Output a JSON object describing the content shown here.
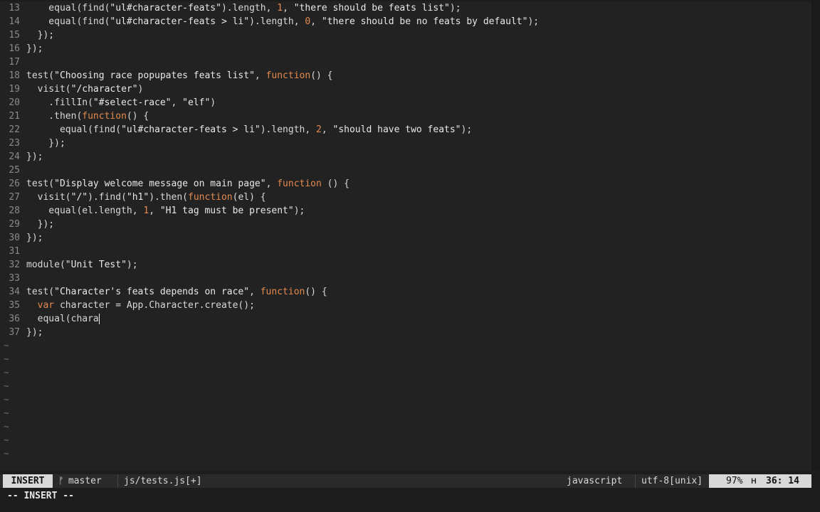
{
  "editor": {
    "lines": [
      {
        "n": "13",
        "parts": [
          {
            "t": "    equal(find(",
            "c": ""
          },
          {
            "t": "\"ul#character-feats\"",
            "c": "s"
          },
          {
            "t": ").length, ",
            "c": ""
          },
          {
            "t": "1",
            "c": "num"
          },
          {
            "t": ", ",
            "c": ""
          },
          {
            "t": "\"there should be feats list\"",
            "c": "s"
          },
          {
            "t": ");",
            "c": ""
          }
        ]
      },
      {
        "n": "14",
        "parts": [
          {
            "t": "    equal(find(",
            "c": ""
          },
          {
            "t": "\"ul#character-feats > li\"",
            "c": "s"
          },
          {
            "t": ").length, ",
            "c": ""
          },
          {
            "t": "0",
            "c": "num"
          },
          {
            "t": ", ",
            "c": ""
          },
          {
            "t": "\"there should be no feats by default\"",
            "c": "s"
          },
          {
            "t": ");",
            "c": ""
          }
        ]
      },
      {
        "n": "15",
        "parts": [
          {
            "t": "  });",
            "c": ""
          }
        ]
      },
      {
        "n": "16",
        "parts": [
          {
            "t": "});",
            "c": ""
          }
        ]
      },
      {
        "n": "17",
        "parts": []
      },
      {
        "n": "18",
        "parts": [
          {
            "t": "test(",
            "c": ""
          },
          {
            "t": "\"Choosing race popupates feats list\"",
            "c": "s"
          },
          {
            "t": ", ",
            "c": ""
          },
          {
            "t": "function",
            "c": "kw"
          },
          {
            "t": "() {",
            "c": ""
          }
        ]
      },
      {
        "n": "19",
        "parts": [
          {
            "t": "  visit(",
            "c": ""
          },
          {
            "t": "\"/character\"",
            "c": "s"
          },
          {
            "t": ")",
            "c": ""
          }
        ]
      },
      {
        "n": "20",
        "parts": [
          {
            "t": "    .fillIn(",
            "c": ""
          },
          {
            "t": "\"#select-race\"",
            "c": "s"
          },
          {
            "t": ", ",
            "c": ""
          },
          {
            "t": "\"elf\"",
            "c": "s"
          },
          {
            "t": ")",
            "c": ""
          }
        ]
      },
      {
        "n": "21",
        "parts": [
          {
            "t": "    .then(",
            "c": ""
          },
          {
            "t": "function",
            "c": "kw"
          },
          {
            "t": "() {",
            "c": ""
          }
        ]
      },
      {
        "n": "22",
        "parts": [
          {
            "t": "      equal(find(",
            "c": ""
          },
          {
            "t": "\"ul#character-feats > li\"",
            "c": "s"
          },
          {
            "t": ").length, ",
            "c": ""
          },
          {
            "t": "2",
            "c": "num"
          },
          {
            "t": ", ",
            "c": ""
          },
          {
            "t": "\"should have two feats\"",
            "c": "s"
          },
          {
            "t": ");",
            "c": ""
          }
        ]
      },
      {
        "n": "23",
        "parts": [
          {
            "t": "    });",
            "c": ""
          }
        ]
      },
      {
        "n": "24",
        "parts": [
          {
            "t": "});",
            "c": ""
          }
        ]
      },
      {
        "n": "25",
        "parts": []
      },
      {
        "n": "26",
        "parts": [
          {
            "t": "test(",
            "c": ""
          },
          {
            "t": "\"Display welcome message on main page\"",
            "c": "s"
          },
          {
            "t": ", ",
            "c": ""
          },
          {
            "t": "function",
            "c": "kw"
          },
          {
            "t": " () {",
            "c": ""
          }
        ]
      },
      {
        "n": "27",
        "parts": [
          {
            "t": "  visit(",
            "c": ""
          },
          {
            "t": "\"/\"",
            "c": "s"
          },
          {
            "t": ").find(",
            "c": ""
          },
          {
            "t": "\"h1\"",
            "c": "s"
          },
          {
            "t": ").then(",
            "c": ""
          },
          {
            "t": "function",
            "c": "kw"
          },
          {
            "t": "(el) {",
            "c": ""
          }
        ]
      },
      {
        "n": "28",
        "parts": [
          {
            "t": "    equal(el.length, ",
            "c": ""
          },
          {
            "t": "1",
            "c": "num"
          },
          {
            "t": ", ",
            "c": ""
          },
          {
            "t": "\"H1 tag must be present\"",
            "c": "s"
          },
          {
            "t": ");",
            "c": ""
          }
        ]
      },
      {
        "n": "29",
        "parts": [
          {
            "t": "  });",
            "c": ""
          }
        ]
      },
      {
        "n": "30",
        "parts": [
          {
            "t": "});",
            "c": ""
          }
        ]
      },
      {
        "n": "31",
        "parts": []
      },
      {
        "n": "32",
        "parts": [
          {
            "t": "module(",
            "c": ""
          },
          {
            "t": "\"Unit Test\"",
            "c": "s"
          },
          {
            "t": ");",
            "c": ""
          }
        ]
      },
      {
        "n": "33",
        "parts": []
      },
      {
        "n": "34",
        "parts": [
          {
            "t": "test(",
            "c": ""
          },
          {
            "t": "\"Character's feats depends on race\"",
            "c": "s"
          },
          {
            "t": ", ",
            "c": ""
          },
          {
            "t": "function",
            "c": "kw"
          },
          {
            "t": "() {",
            "c": ""
          }
        ]
      },
      {
        "n": "35",
        "parts": [
          {
            "t": "  ",
            "c": ""
          },
          {
            "t": "var",
            "c": "kw"
          },
          {
            "t": " character = App.Character.create();",
            "c": ""
          }
        ]
      },
      {
        "n": "36",
        "parts": [
          {
            "t": "  equal(chara",
            "c": ""
          }
        ],
        "cursor": true
      },
      {
        "n": "37",
        "parts": [
          {
            "t": "});",
            "c": ""
          }
        ]
      }
    ],
    "tilde_count": 9,
    "tilde_glyph": "~"
  },
  "statusline": {
    "mode": "INSERT",
    "branch_glyph": "ᚠ",
    "branch": "master",
    "file": "js/tests.js[+]",
    "filetype": "javascript",
    "encoding": "utf-8[unix]",
    "percent": "97%",
    "percent_sep": "ʜ",
    "position": "36: 14"
  },
  "cmdline": {
    "text": "-- INSERT --"
  },
  "colors": {
    "background": "#222222",
    "string": "#e8e8e8",
    "keyword": "#e58a4f",
    "number": "#e58a4f",
    "linenr": "#8a8a8a",
    "statusline_accent": "#d8d8d8"
  }
}
